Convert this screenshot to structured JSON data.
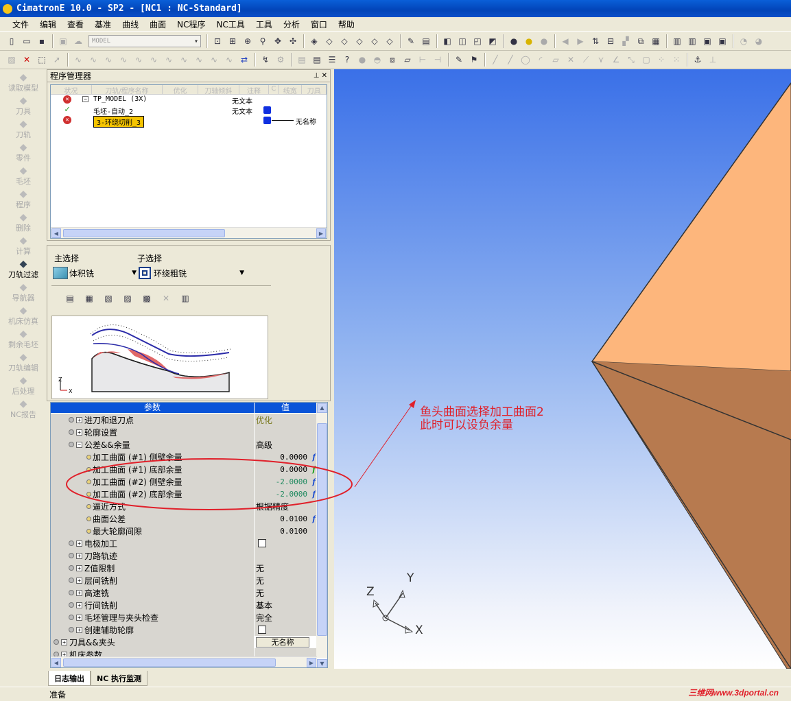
{
  "window": {
    "title": "CimatronE 10.0 - SP2 - [NC1 : NC-Standard]"
  },
  "menu": [
    "文件",
    "编辑",
    "查看",
    "基准",
    "曲线",
    "曲面",
    "NC程序",
    "NC工具",
    "工具",
    "分析",
    "窗口",
    "帮助"
  ],
  "toolbar": {
    "model_combo": "MODEL"
  },
  "leftbar": [
    {
      "label": "读取模型",
      "icon": "load-model-icon",
      "active": false
    },
    {
      "label": "刀具",
      "icon": "tool-icon",
      "active": false
    },
    {
      "label": "刀轨",
      "icon": "toolpath-icon",
      "active": false
    },
    {
      "label": "零件",
      "icon": "part-icon",
      "active": false
    },
    {
      "label": "毛坯",
      "icon": "stock-icon",
      "active": false
    },
    {
      "label": "程序",
      "icon": "procedure-icon",
      "active": false
    },
    {
      "label": "删除",
      "icon": "delete-icon",
      "active": false
    },
    {
      "label": "计算",
      "icon": "compute-icon",
      "active": false
    },
    {
      "label": "刀轨过滤",
      "icon": "filter-icon",
      "active": true
    },
    {
      "label": "导航器",
      "icon": "navigator-icon",
      "active": false
    },
    {
      "label": "机床仿真",
      "icon": "simulation-icon",
      "active": false
    },
    {
      "label": "剩余毛坯",
      "icon": "remaining-stock-icon",
      "active": false
    },
    {
      "label": "刀轨编辑",
      "icon": "toolpath-edit-icon",
      "active": false
    },
    {
      "label": "后处理",
      "icon": "post-process-icon",
      "active": false
    },
    {
      "label": "NC报告",
      "icon": "nc-report-icon",
      "active": false
    }
  ],
  "program_manager": {
    "title": "程序管理器",
    "columns": [
      "状况",
      "刀轨/程序名称",
      "优化",
      "刀轴倾斜",
      "注释",
      "C",
      "线宽",
      "刀具"
    ],
    "rows": [
      {
        "status": "error",
        "name": "TP_MODEL (3X)",
        "note": "无文本",
        "tool": ""
      },
      {
        "status": "ok",
        "name": "毛坯-自动_2",
        "note": "无文本",
        "tool": ""
      },
      {
        "status": "error",
        "name": "3-环绕切削_3",
        "note": "",
        "tool": "无名称"
      }
    ]
  },
  "selection": {
    "main_label": "主选择",
    "main_value": "体积铣",
    "sub_label": "子选择",
    "sub_value": "环绕粗铣"
  },
  "params": {
    "header_name": "参数",
    "header_value": "值",
    "rows": [
      {
        "name": "进刀和退刀点",
        "value": "优化",
        "level": 1,
        "type": "group",
        "vcolor": "#7a7a20"
      },
      {
        "name": "轮廓设置",
        "value": "",
        "level": 1,
        "type": "group"
      },
      {
        "name": "公差&&余量",
        "value": "高级",
        "level": 1,
        "type": "open"
      },
      {
        "name": "加工曲面 (#1) 侧壁余量",
        "value": "0.0000",
        "level": 2,
        "type": "num",
        "f": "blue"
      },
      {
        "name": "加工曲面 (#1) 底部余量",
        "value": "0.0000",
        "level": 2,
        "type": "num",
        "f": "green"
      },
      {
        "name": "加工曲面 (#2) 侧壁余量",
        "value": "-2.0000",
        "level": 2,
        "type": "num",
        "f": "blue",
        "vcolor": "#208a60"
      },
      {
        "name": "加工曲面 (#2) 底部余量",
        "value": "-2.0000",
        "level": 2,
        "type": "num",
        "f": "blue",
        "vcolor": "#208a60"
      },
      {
        "name": "逼近方式",
        "value": "根据精度",
        "level": 2,
        "type": "text"
      },
      {
        "name": "曲面公差",
        "value": "0.0100",
        "level": 2,
        "type": "num",
        "f": "blue"
      },
      {
        "name": "最大轮廓间隙",
        "value": "0.0100",
        "level": 2,
        "type": "num",
        "f": ""
      },
      {
        "name": "电极加工",
        "value": "",
        "level": 1,
        "type": "check"
      },
      {
        "name": "刀路轨迹",
        "value": "",
        "level": 1,
        "type": "group"
      },
      {
        "name": "Z值限制",
        "value": "无",
        "level": 1,
        "type": "group"
      },
      {
        "name": "层间铣削",
        "value": "无",
        "level": 1,
        "type": "group"
      },
      {
        "name": "高速铣",
        "value": "无",
        "level": 1,
        "type": "group"
      },
      {
        "name": "行间铣削",
        "value": "基本",
        "level": 1,
        "type": "group"
      },
      {
        "name": "毛坯管理与夹头检查",
        "value": "完全",
        "level": 1,
        "type": "group"
      },
      {
        "name": "创建辅助轮廓",
        "value": "",
        "level": 1,
        "type": "check"
      },
      {
        "name": "刀具&&夹头",
        "value": "无名称",
        "level": 0,
        "type": "button"
      },
      {
        "name": "机床参数",
        "value": "",
        "level": 0,
        "type": "group"
      }
    ]
  },
  "annotation": {
    "line1": "鱼头曲面选择加工曲面2",
    "line2": "此时可以设负余量",
    "color": "#e0202a"
  },
  "axes": {
    "x": "X",
    "y": "Y",
    "z": "Z"
  },
  "bottom_tabs": [
    "日志输出",
    "NC 执行监测"
  ],
  "status": "准备",
  "watermark": "三维网www.3dportal.cn"
}
